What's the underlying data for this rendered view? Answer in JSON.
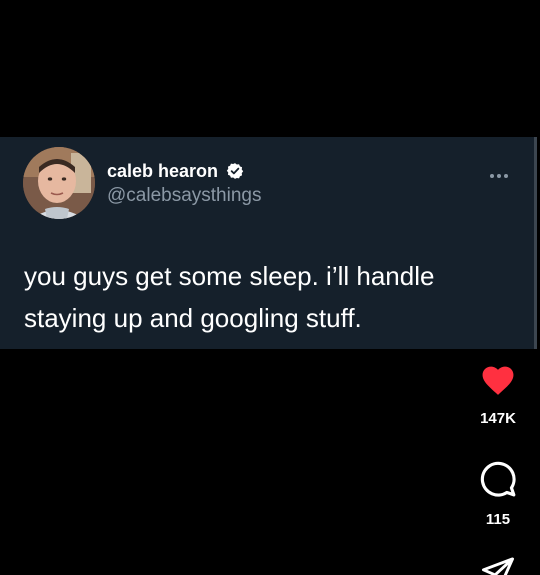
{
  "tweet": {
    "author_name": "caleb hearon",
    "author_handle": "@calebsaysthings",
    "verified": true,
    "text": "you guys get some sleep. i’ll handle\nstaying up and googling stuff.",
    "background_color": "#15202b"
  },
  "actions": {
    "like": {
      "icon": "heart-icon",
      "count": "147K",
      "color": "#ff3040",
      "liked": true
    },
    "comment": {
      "icon": "comment-icon",
      "count": "115"
    },
    "share": {
      "icon": "send-icon"
    }
  },
  "colors": {
    "page_background": "#000000",
    "secondary_text": "#8b98a5",
    "verified_badge": "#ffffff"
  }
}
